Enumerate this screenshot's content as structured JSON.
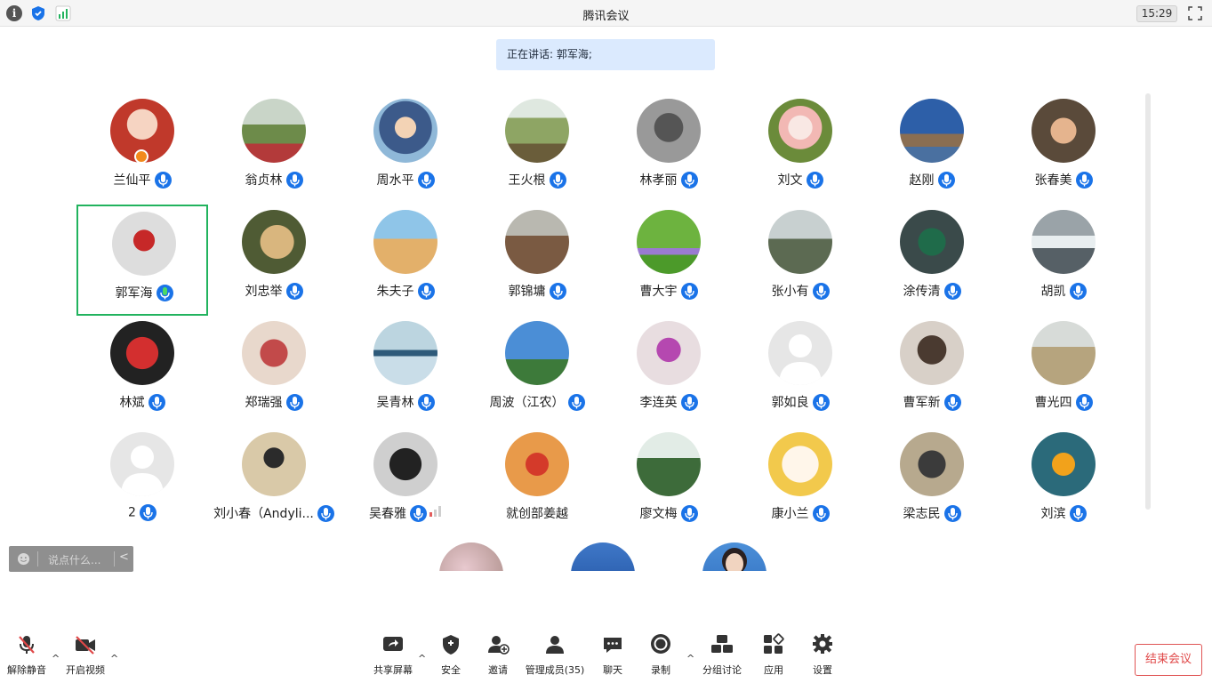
{
  "window": {
    "title": "腾讯会议",
    "clock": "15:29",
    "info_glyph": "i"
  },
  "speaking": {
    "label": "正在讲话: 郭军海;"
  },
  "participants": [
    {
      "name": "兰仙平",
      "mic": "blue",
      "host": true
    },
    {
      "name": "翁贞林",
      "mic": "blue"
    },
    {
      "name": "周水平",
      "mic": "blue"
    },
    {
      "name": "王火根",
      "mic": "blue"
    },
    {
      "name": "林孝丽",
      "mic": "blue"
    },
    {
      "name": "刘文",
      "mic": "blue"
    },
    {
      "name": "赵刚",
      "mic": "blue"
    },
    {
      "name": "张春美",
      "mic": "blue"
    },
    {
      "name": "郭军海",
      "mic": "speaking",
      "active": true
    },
    {
      "name": "刘忠举",
      "mic": "blue"
    },
    {
      "name": "朱夫子",
      "mic": "blue"
    },
    {
      "name": "郭锦墉",
      "mic": "blue"
    },
    {
      "name": "曹大宇",
      "mic": "blue"
    },
    {
      "name": "张小有",
      "mic": "blue"
    },
    {
      "name": "涂传清",
      "mic": "blue"
    },
    {
      "name": "胡凯",
      "mic": "blue"
    },
    {
      "name": "林斌",
      "mic": "blue"
    },
    {
      "name": "郑瑞强",
      "mic": "blue"
    },
    {
      "name": "吴青林",
      "mic": "blue"
    },
    {
      "name": "周波（江农）",
      "mic": "blue"
    },
    {
      "name": "李连英",
      "mic": "blue"
    },
    {
      "name": "郭如良",
      "mic": "blue"
    },
    {
      "name": "曹军新",
      "mic": "blue"
    },
    {
      "name": "曹光四",
      "mic": "blue"
    },
    {
      "name": "2",
      "mic": "blue"
    },
    {
      "name": "刘小春（Andyli...",
      "mic": "blue"
    },
    {
      "name": "吴春雅",
      "mic": "blue",
      "level": true
    },
    {
      "name": "就创部姜越",
      "mic": "none"
    },
    {
      "name": "廖文梅",
      "mic": "blue"
    },
    {
      "name": "康小兰",
      "mic": "blue"
    },
    {
      "name": "梁志民",
      "mic": "blue"
    },
    {
      "name": "刘滨",
      "mic": "blue"
    }
  ],
  "chat": {
    "placeholder": "说点什么...",
    "arrow": "<"
  },
  "toolbar": {
    "unmute": "解除静音",
    "start_video": "开启视频",
    "share": "共享屏幕",
    "security": "安全",
    "invite": "邀请",
    "manage": "管理成员(35)",
    "chat": "聊天",
    "record": "录制",
    "breakout": "分组讨论",
    "apps": "应用",
    "settings": "设置",
    "end": "结束会议",
    "caret": "^"
  },
  "colors": {
    "accent": "#1a73e8",
    "active_border": "#22b35e",
    "end_red": "#e04848",
    "banner": "#dbeafe"
  }
}
